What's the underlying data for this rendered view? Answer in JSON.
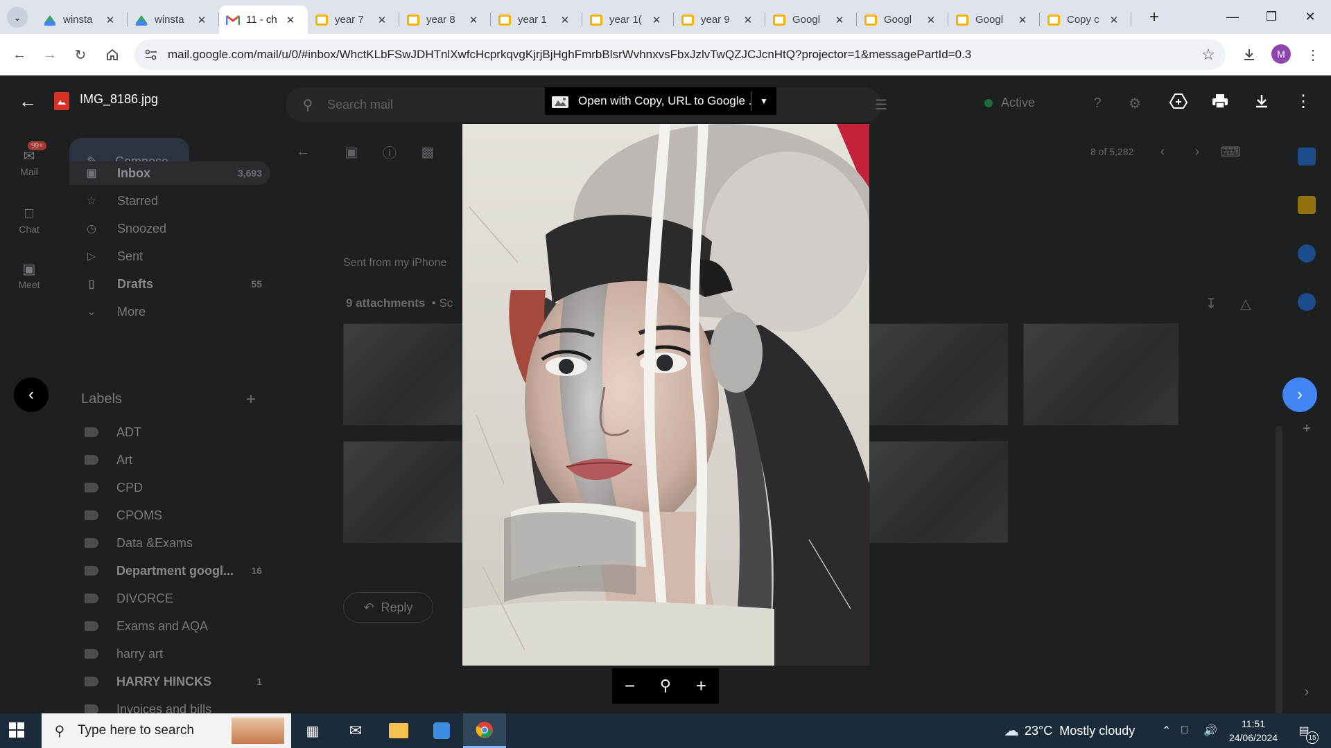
{
  "browser": {
    "tabs": [
      {
        "title": "winsta",
        "favicon": "google-sites-icon"
      },
      {
        "title": "winsta",
        "favicon": "google-sites-icon"
      },
      {
        "title": "11 - ch",
        "favicon": "gmail-icon",
        "active": true
      },
      {
        "title": "year 7",
        "favicon": "google-slides-icon"
      },
      {
        "title": "year 8",
        "favicon": "google-slides-icon"
      },
      {
        "title": "year 1",
        "favicon": "google-slides-icon"
      },
      {
        "title": "year 1(",
        "favicon": "google-slides-icon"
      },
      {
        "title": "year 9",
        "favicon": "google-slides-icon"
      },
      {
        "title": "Googl",
        "favicon": "google-slides-icon"
      },
      {
        "title": "Googl",
        "favicon": "google-slides-icon"
      },
      {
        "title": "Googl",
        "favicon": "google-slides-icon"
      },
      {
        "title": "Copy c",
        "favicon": "google-slides-icon"
      }
    ],
    "url": "mail.google.com/mail/u/0/#inbox/WhctKLbFSwJDHTnlXwfcHcprkqvgKjrjBjHghFmrbBlsrWvhnxvsFbxJzlvTwQZJCJcnHtQ?projector=1&messagePartId=0.3",
    "profile_initial": "M"
  },
  "gmail": {
    "rail": {
      "mail": {
        "label": "Mail",
        "badge": "99+"
      },
      "chat": {
        "label": "Chat"
      },
      "meet": {
        "label": "Meet"
      }
    },
    "compose_label": "Compose",
    "search_placeholder": "Search mail",
    "status": "Active",
    "nav": [
      {
        "label": "Inbox",
        "count": "3,693",
        "icon": "inbox-icon"
      },
      {
        "label": "Starred",
        "count": "",
        "icon": "star-icon"
      },
      {
        "label": "Snoozed",
        "count": "",
        "icon": "clock-icon"
      },
      {
        "label": "Sent",
        "count": "",
        "icon": "send-icon"
      },
      {
        "label": "Drafts",
        "count": "55",
        "icon": "draft-icon"
      },
      {
        "label": "More",
        "count": "",
        "icon": "chevron-down-icon"
      }
    ],
    "labels_heading": "Labels",
    "labels": [
      {
        "label": "ADT",
        "count": ""
      },
      {
        "label": "Art",
        "count": ""
      },
      {
        "label": "CPD",
        "count": ""
      },
      {
        "label": "CPOMS",
        "count": ""
      },
      {
        "label": "Data &Exams",
        "count": ""
      },
      {
        "label": "Department googl...",
        "count": "16"
      },
      {
        "label": "DIVORCE",
        "count": ""
      },
      {
        "label": "Exams and AQA",
        "count": ""
      },
      {
        "label": "harry art",
        "count": ""
      },
      {
        "label": "HARRY HINCKS",
        "count": "1"
      },
      {
        "label": "Invoices and bills",
        "count": ""
      }
    ],
    "message": {
      "pager": "8 of 5,282",
      "body": "Sent from my iPhone",
      "attachments_label": "9 attachments",
      "attachments_suffix": "• Sc",
      "reply_label": "Reply"
    }
  },
  "viewer": {
    "file_name": "IMG_8186.jpg",
    "open_with_label": "Open with Copy, URL to Google ...",
    "photo_subject": "torn-paper collage portrait drawing of a woman"
  },
  "taskbar": {
    "search_placeholder": "Type here to search",
    "weather": "23°C  Mostly cloudy",
    "time": "11:51",
    "date": "24/06/2024",
    "notification_count": "15"
  }
}
